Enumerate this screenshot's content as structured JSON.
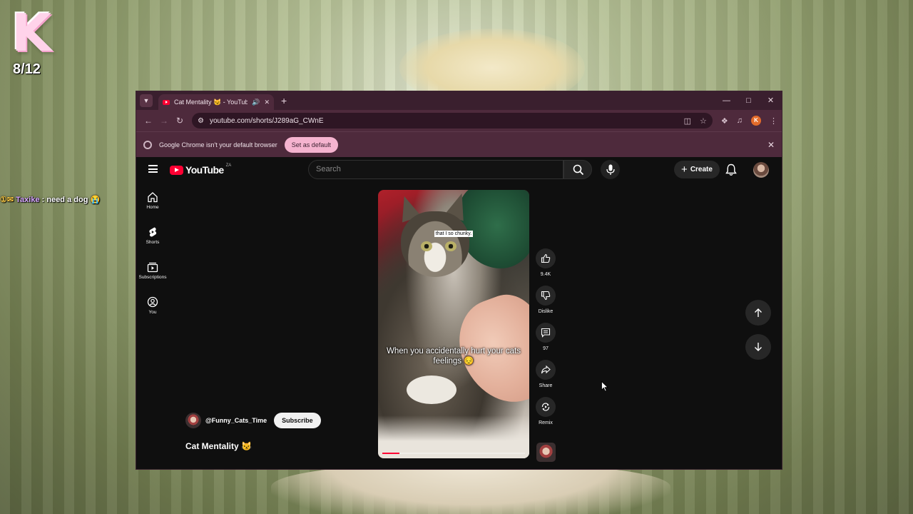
{
  "overlay": {
    "logo_letter": "K",
    "counter": "8/12",
    "chat": {
      "badges": "①✉",
      "user": "Taxike",
      "message": " : need a dog 😭"
    }
  },
  "browser": {
    "tab_title": "Cat Mentality 😼 - YouTube",
    "tab_audio": "🔊",
    "url": "youtube.com/shorts/J289aG_CWnE",
    "profile_initial": "K",
    "infobar_text": "Google Chrome isn't your default browser",
    "set_default_label": "Set as default"
  },
  "youtube": {
    "logo_text": "YouTube",
    "country_code": "ZA",
    "search_placeholder": "Search",
    "create_label": "Create",
    "sidebar": [
      {
        "label": "Home",
        "icon": "home-icon"
      },
      {
        "label": "Shorts",
        "icon": "shorts-icon"
      },
      {
        "label": "Subscriptions",
        "icon": "subscriptions-icon"
      },
      {
        "label": "You",
        "icon": "you-icon"
      }
    ],
    "short": {
      "caption_top": "that I so chunky.",
      "caption_main": "When you accidentally hurt your cats feelings 😔",
      "progress": 0.12
    },
    "actions": {
      "like_count": "9.4K",
      "dislike_label": "Dislike",
      "comment_count": "97",
      "share_label": "Share",
      "remix_label": "Remix"
    },
    "channel": {
      "handle": "@Funny_Cats_Time",
      "subscribe_label": "Subscribe",
      "video_title": "Cat Mentality 😼"
    }
  },
  "colors": {
    "accent": "#ff0033",
    "chrome_frame": "#4e2a3c",
    "set_default_bg": "#f5b3cf"
  }
}
